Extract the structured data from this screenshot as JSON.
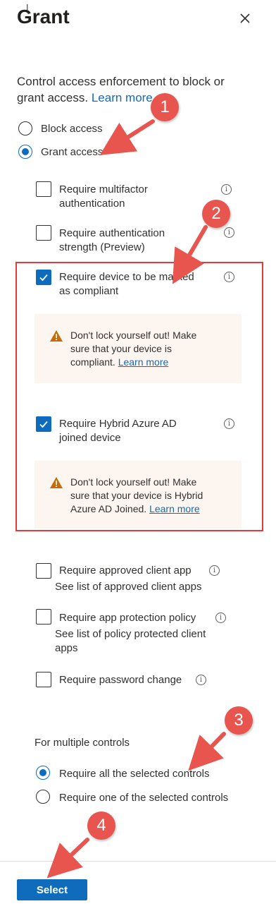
{
  "header": {
    "title": "Grant"
  },
  "description": {
    "text": "Control access enforcement to block or grant access. ",
    "link": "Learn more"
  },
  "access": {
    "block_label": "Block access",
    "grant_label": "Grant access",
    "selected": "grant"
  },
  "controls": {
    "mfa": {
      "line1": "Require multifactor",
      "line2": "authentication",
      "checked": false
    },
    "auth_strength": {
      "line1": "Require authentication",
      "line2": "strength (Preview)",
      "checked": false
    },
    "compliant": {
      "line1": "Require device to be marked",
      "line2": "as compliant",
      "checked": true
    },
    "compliant_warning": {
      "line1": "Don't lock yourself out! Make",
      "line2": "sure that your device is",
      "line3": "compliant. ",
      "link": "Learn more"
    },
    "hybrid": {
      "line1": "Require Hybrid Azure AD",
      "line2": "joined device",
      "checked": true
    },
    "hybrid_warning": {
      "line1": "Don't lock yourself out! Make",
      "line2": "sure that your device is Hybrid",
      "line3": "Azure AD Joined. ",
      "link": "Learn more"
    },
    "approved_app": {
      "label": "Require approved client app",
      "link": "See list of approved client apps",
      "checked": false
    },
    "app_protection": {
      "label": "Require app protection policy",
      "link_line1": "See list of policy protected client",
      "link_line2": "apps",
      "checked": false
    },
    "password_change": {
      "label": "Require password change",
      "checked": false
    }
  },
  "multiple": {
    "heading": "For multiple controls",
    "require_all_label": "Require all the selected controls",
    "require_one_label": "Require one of the selected controls",
    "selected": "all"
  },
  "annotations": {
    "b1": "1",
    "b2": "2",
    "b3": "3",
    "b4": "4"
  },
  "footer": {
    "select_label": "Select"
  },
  "colors": {
    "accent": "#0f6cbd",
    "annotation": "#e8554e",
    "warning": "#c86b04",
    "highlight_border": "#e03c3c"
  },
  "icons": {
    "close": "close-icon",
    "info": "info-icon",
    "warning": "warning-icon",
    "checkmark": "checkmark-icon",
    "arrow": "arrow-icon"
  }
}
